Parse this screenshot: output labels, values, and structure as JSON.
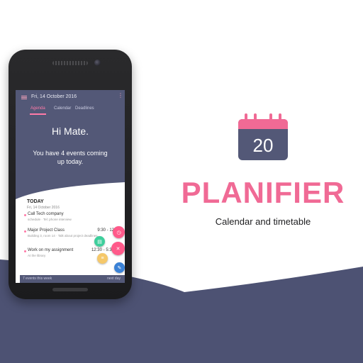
{
  "colors": {
    "brand_pink": "#f06a95",
    "navy": "#4d5273",
    "header_bg": "#535877",
    "fab_pink": "#ff5a8a",
    "fab_green": "#3ecf9c",
    "fab_yellow": "#f5c86a",
    "fab_blue": "#3b82d6"
  },
  "brand": {
    "icon_day": "20",
    "name": "PLANIFIER",
    "tagline": "Calendar and timetable"
  },
  "app": {
    "toolbar": {
      "date_title": "Fri, 14 October 2016",
      "menu_icon": "hamburger-icon",
      "more_icon": "more-vertical-icon"
    },
    "tabs": [
      {
        "label": "Agenda",
        "active": true
      },
      {
        "label": "Calendar",
        "active": false
      },
      {
        "label": "Deadlines",
        "active": false
      }
    ],
    "greeting": "Hi Mate.",
    "summary_line1": "You have 4 events coming",
    "summary_line2": "up today.",
    "section_title": "TODAY",
    "section_date": "Fri, 14 October 2016",
    "events": [
      {
        "title": "Call Tech company",
        "time": "",
        "subtitle": "schedule · Tel: phone interview"
      },
      {
        "title": "Major Project Class",
        "time": "9:30 - 12PM",
        "subtitle": "Building 3, room 14 · Talk about project deadlines"
      },
      {
        "title": "Work on my assignment",
        "time": "12:30 - 5:30PM",
        "subtitle": "At the library"
      }
    ],
    "bottom_bar": {
      "left": "7 events this week",
      "right": "next day"
    },
    "fab_icons": [
      "timer-icon",
      "note-icon",
      "close-icon",
      "list-icon",
      "pencil-icon"
    ]
  }
}
